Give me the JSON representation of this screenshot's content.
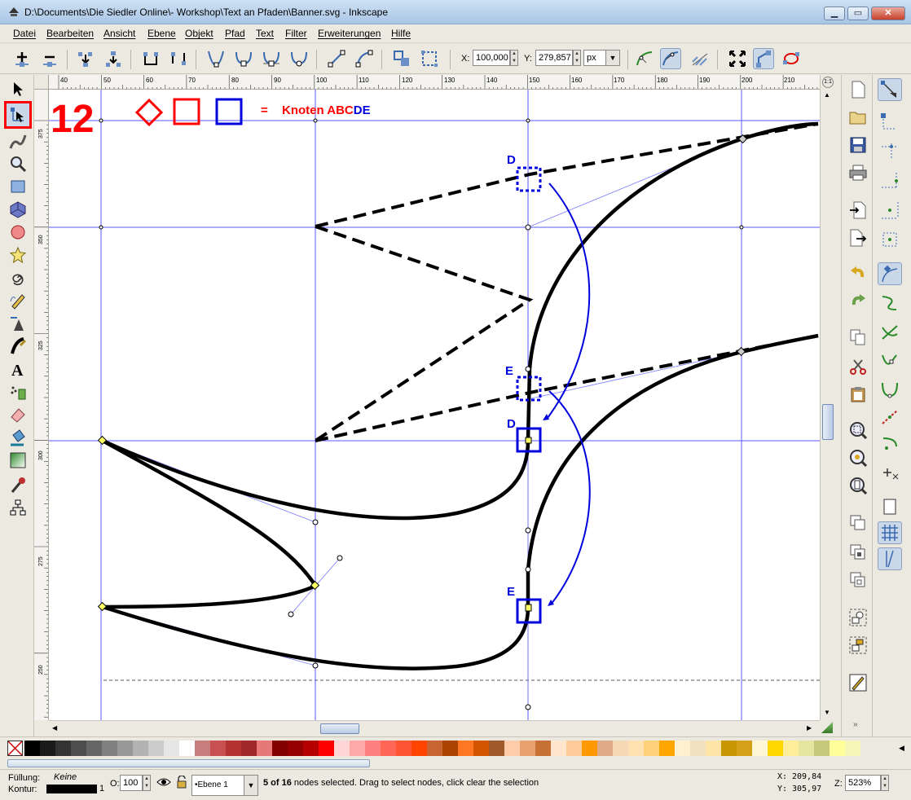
{
  "window": {
    "title": "D:\\Documents\\Die Siedler Online\\- Workshop\\Text an Pfaden\\Banner.svg - Inkscape",
    "minimize": "▁",
    "maximize": "▭",
    "close": "✕"
  },
  "menu": {
    "items": [
      "Datei",
      "Bearbeiten",
      "Ansicht",
      "Ebene",
      "Objekt",
      "Pfad",
      "Text",
      "Filter",
      "Erweiterungen",
      "Hilfe"
    ]
  },
  "controls": {
    "x_label": "X:",
    "x_value": "100,000",
    "y_label": "Y:",
    "y_value": "279,857",
    "unit": "px"
  },
  "rulers": {
    "h_ticks": [
      "40",
      "50",
      "60",
      "70",
      "80",
      "90",
      "100",
      "110",
      "120",
      "130",
      "140",
      "150",
      "160",
      "170",
      "180",
      "190",
      "200",
      "210"
    ],
    "v_ticks": [
      "375",
      "350",
      "325",
      "300",
      "275",
      "250"
    ],
    "corner": "1:1"
  },
  "annotations": {
    "step_number": "12",
    "equals": "=",
    "legend_text": "Knoten ABC",
    "legend_text_blue": "DE",
    "label_d_top": "D",
    "label_e_top": "E",
    "label_d_bottom": "D",
    "label_e_bottom": "E",
    "colors": {
      "red": "#ff0000",
      "blue": "#0000dd"
    }
  },
  "palette": {
    "none_icon": "no-paint-icon",
    "swatches": [
      "#000000",
      "#1a1a1a",
      "#333333",
      "#4d4d4d",
      "#666666",
      "#808080",
      "#999999",
      "#b3b3b3",
      "#cccccc",
      "#e6e6e6",
      "#ffffff",
      "#c87d7d",
      "#c85050",
      "#b43232",
      "#a02828",
      "#e67878",
      "#800000",
      "#960000",
      "#b40000",
      "#ff0000",
      "#ffd5d5",
      "#ffaaaa",
      "#ff8080",
      "#ff6655",
      "#ff5533",
      "#ff4400",
      "#c86432",
      "#aa4400",
      "#ff7722",
      "#d45500",
      "#a05a2c",
      "#ffccaa",
      "#e9a070",
      "#c87137",
      "#ffe6cc",
      "#ffcc99",
      "#ff9900",
      "#deaa87",
      "#f4d7b4",
      "#ffe0b0",
      "#ffd07a",
      "#ffa500",
      "#fff0d0",
      "#f0e0c0",
      "#ffe4a8",
      "#c89600",
      "#d4a017",
      "#fff6d5",
      "#ffd700",
      "#ffee99",
      "#e6e6a0",
      "#c8c87a",
      "#ffff99",
      "#f5f5b8"
    ]
  },
  "status": {
    "fill_label": "Füllung:",
    "fill_value": "Keine",
    "stroke_label": "Kontur:",
    "stroke_width": "1",
    "opacity_label": "O:",
    "opacity_value": "100",
    "layer": "•Ebene 1",
    "message_bold": "5 of 16",
    "message": " nodes selected. Drag to select nodes, click clear the selection",
    "x_label": "X:",
    "x_value": "209,84",
    "y_label": "Y:",
    "y_value": "305,97",
    "zoom_label": "Z:",
    "zoom_value": "523%"
  }
}
